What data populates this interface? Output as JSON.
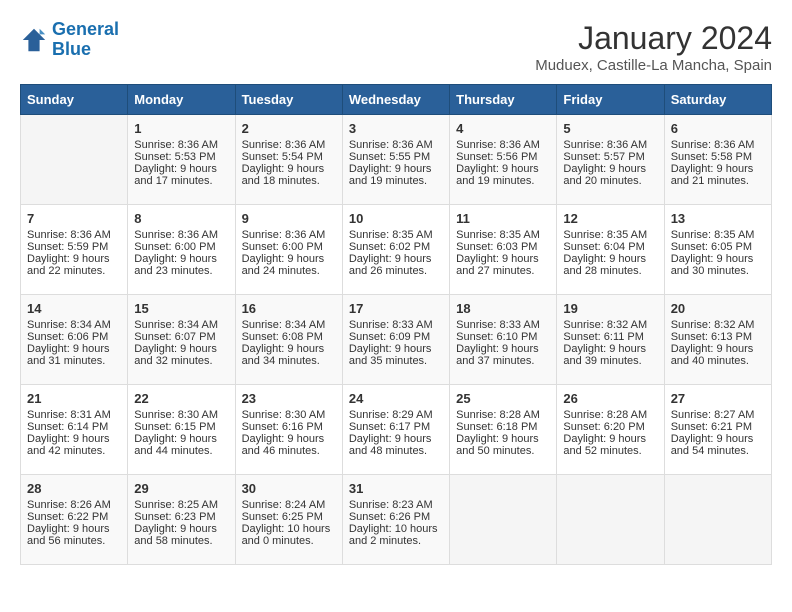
{
  "header": {
    "logo_line1": "General",
    "logo_line2": "Blue",
    "month": "January 2024",
    "location": "Muduex, Castille-La Mancha, Spain"
  },
  "days_of_week": [
    "Sunday",
    "Monday",
    "Tuesday",
    "Wednesday",
    "Thursday",
    "Friday",
    "Saturday"
  ],
  "weeks": [
    [
      {
        "day": "",
        "content": ""
      },
      {
        "day": "1",
        "content": "Sunrise: 8:36 AM\nSunset: 5:53 PM\nDaylight: 9 hours\nand 17 minutes."
      },
      {
        "day": "2",
        "content": "Sunrise: 8:36 AM\nSunset: 5:54 PM\nDaylight: 9 hours\nand 18 minutes."
      },
      {
        "day": "3",
        "content": "Sunrise: 8:36 AM\nSunset: 5:55 PM\nDaylight: 9 hours\nand 19 minutes."
      },
      {
        "day": "4",
        "content": "Sunrise: 8:36 AM\nSunset: 5:56 PM\nDaylight: 9 hours\nand 19 minutes."
      },
      {
        "day": "5",
        "content": "Sunrise: 8:36 AM\nSunset: 5:57 PM\nDaylight: 9 hours\nand 20 minutes."
      },
      {
        "day": "6",
        "content": "Sunrise: 8:36 AM\nSunset: 5:58 PM\nDaylight: 9 hours\nand 21 minutes."
      }
    ],
    [
      {
        "day": "7",
        "content": "Sunrise: 8:36 AM\nSunset: 5:59 PM\nDaylight: 9 hours\nand 22 minutes."
      },
      {
        "day": "8",
        "content": "Sunrise: 8:36 AM\nSunset: 6:00 PM\nDaylight: 9 hours\nand 23 minutes."
      },
      {
        "day": "9",
        "content": "Sunrise: 8:36 AM\nSunset: 6:00 PM\nDaylight: 9 hours\nand 24 minutes."
      },
      {
        "day": "10",
        "content": "Sunrise: 8:35 AM\nSunset: 6:02 PM\nDaylight: 9 hours\nand 26 minutes."
      },
      {
        "day": "11",
        "content": "Sunrise: 8:35 AM\nSunset: 6:03 PM\nDaylight: 9 hours\nand 27 minutes."
      },
      {
        "day": "12",
        "content": "Sunrise: 8:35 AM\nSunset: 6:04 PM\nDaylight: 9 hours\nand 28 minutes."
      },
      {
        "day": "13",
        "content": "Sunrise: 8:35 AM\nSunset: 6:05 PM\nDaylight: 9 hours\nand 30 minutes."
      }
    ],
    [
      {
        "day": "14",
        "content": "Sunrise: 8:34 AM\nSunset: 6:06 PM\nDaylight: 9 hours\nand 31 minutes."
      },
      {
        "day": "15",
        "content": "Sunrise: 8:34 AM\nSunset: 6:07 PM\nDaylight: 9 hours\nand 32 minutes."
      },
      {
        "day": "16",
        "content": "Sunrise: 8:34 AM\nSunset: 6:08 PM\nDaylight: 9 hours\nand 34 minutes."
      },
      {
        "day": "17",
        "content": "Sunrise: 8:33 AM\nSunset: 6:09 PM\nDaylight: 9 hours\nand 35 minutes."
      },
      {
        "day": "18",
        "content": "Sunrise: 8:33 AM\nSunset: 6:10 PM\nDaylight: 9 hours\nand 37 minutes."
      },
      {
        "day": "19",
        "content": "Sunrise: 8:32 AM\nSunset: 6:11 PM\nDaylight: 9 hours\nand 39 minutes."
      },
      {
        "day": "20",
        "content": "Sunrise: 8:32 AM\nSunset: 6:13 PM\nDaylight: 9 hours\nand 40 minutes."
      }
    ],
    [
      {
        "day": "21",
        "content": "Sunrise: 8:31 AM\nSunset: 6:14 PM\nDaylight: 9 hours\nand 42 minutes."
      },
      {
        "day": "22",
        "content": "Sunrise: 8:30 AM\nSunset: 6:15 PM\nDaylight: 9 hours\nand 44 minutes."
      },
      {
        "day": "23",
        "content": "Sunrise: 8:30 AM\nSunset: 6:16 PM\nDaylight: 9 hours\nand 46 minutes."
      },
      {
        "day": "24",
        "content": "Sunrise: 8:29 AM\nSunset: 6:17 PM\nDaylight: 9 hours\nand 48 minutes."
      },
      {
        "day": "25",
        "content": "Sunrise: 8:28 AM\nSunset: 6:18 PM\nDaylight: 9 hours\nand 50 minutes."
      },
      {
        "day": "26",
        "content": "Sunrise: 8:28 AM\nSunset: 6:20 PM\nDaylight: 9 hours\nand 52 minutes."
      },
      {
        "day": "27",
        "content": "Sunrise: 8:27 AM\nSunset: 6:21 PM\nDaylight: 9 hours\nand 54 minutes."
      }
    ],
    [
      {
        "day": "28",
        "content": "Sunrise: 8:26 AM\nSunset: 6:22 PM\nDaylight: 9 hours\nand 56 minutes."
      },
      {
        "day": "29",
        "content": "Sunrise: 8:25 AM\nSunset: 6:23 PM\nDaylight: 9 hours\nand 58 minutes."
      },
      {
        "day": "30",
        "content": "Sunrise: 8:24 AM\nSunset: 6:25 PM\nDaylight: 10 hours\nand 0 minutes."
      },
      {
        "day": "31",
        "content": "Sunrise: 8:23 AM\nSunset: 6:26 PM\nDaylight: 10 hours\nand 2 minutes."
      },
      {
        "day": "",
        "content": ""
      },
      {
        "day": "",
        "content": ""
      },
      {
        "day": "",
        "content": ""
      }
    ]
  ]
}
